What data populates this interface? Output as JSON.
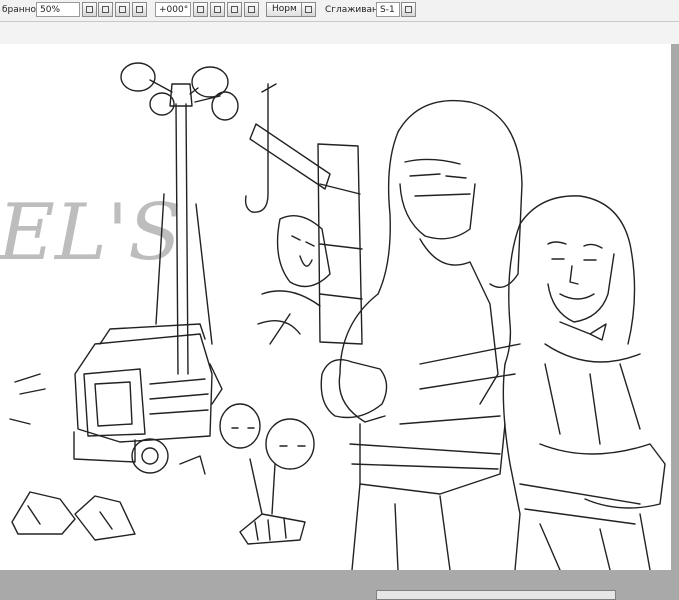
{
  "toolbar": {
    "favorites_label": "бранное",
    "zoom_value": "50%",
    "rotation_value": "+000°",
    "blend_mode_button": "Норм",
    "smoothing_label": "Сглаживание",
    "smoothing_value": "S-1"
  },
  "canvas": {
    "sign_text": "EL'S",
    "background": "#ffffff"
  },
  "icons": [
    "zoom-dropdown-icon",
    "zoom-out-icon",
    "zoom-in-icon",
    "zoom-fit-icon",
    "rotation-dropdown-icon",
    "rotate-left-icon",
    "rotate-right-icon",
    "rotate-reset-icon",
    "flip-icon",
    "smoothing-dropdown-icon"
  ]
}
